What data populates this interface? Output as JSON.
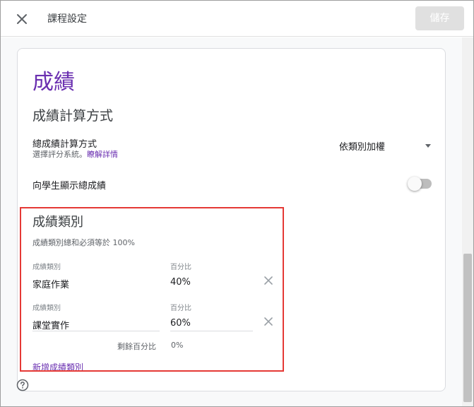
{
  "topbar": {
    "title": "課程設定",
    "save_label": "儲存"
  },
  "grades": {
    "heading": "成績",
    "calc_heading": "成績計算方式",
    "overall": {
      "label": "總成績計算方式",
      "sub_text": "選擇評分系統。",
      "learn_more": "瞭解詳情",
      "selected": "依類別加權"
    },
    "show_overall": {
      "label": "向學生顯示總成績",
      "enabled": false
    }
  },
  "categories": {
    "title": "成績類別",
    "note": "成績類別總和必須等於 100%",
    "category_label": "成績類別",
    "percent_label": "百分比",
    "items": [
      {
        "name": "家庭作業",
        "percent": "40%"
      },
      {
        "name": "課堂實作",
        "percent": "60%"
      }
    ],
    "remaining_label": "剩餘百分比",
    "remaining_value": "0%",
    "add_label": "新增成績類別"
  },
  "colors": {
    "accent": "#6a2fb0",
    "highlight": "#e53935"
  }
}
